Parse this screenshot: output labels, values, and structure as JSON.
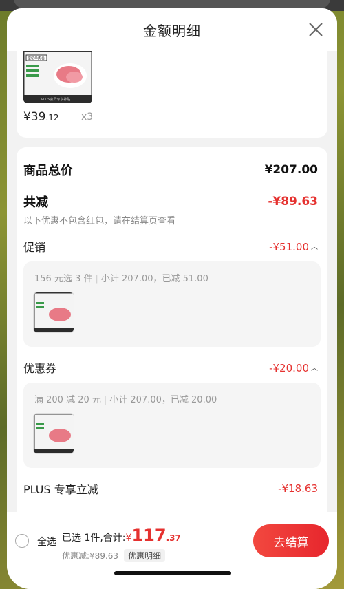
{
  "sheet": {
    "title": "金额明细"
  },
  "product": {
    "thumb_title": "原切羊肉卷",
    "thumb_footer": "PLUS会员专享补贴",
    "price_int": "¥39",
    "price_dec": ".12",
    "qty": "x3"
  },
  "summary": {
    "total_label": "商品总价",
    "total_value": "¥207.00",
    "discount_label": "共减",
    "discount_value": "-¥89.63",
    "note": "以下优惠不包含红包，请在结算页查看"
  },
  "promo": {
    "label": "促销",
    "value": "-¥51.00",
    "detail_rule": "156 元选 3 件",
    "detail_subtotal": "小计 207.00，已减 51.00"
  },
  "coupon": {
    "label": "优惠券",
    "value": "-¥20.00",
    "detail_rule": "满 200 减 20 元",
    "detail_subtotal": "小计 207.00，已减 20.00"
  },
  "plus": {
    "label": "PLUS 专享立减",
    "value": "-¥18.63"
  },
  "bottom": {
    "select_all": "全选",
    "selected_text": "已选 1件,合计:",
    "currency": "¥",
    "total_int": "117",
    "total_dec": ".37",
    "discount_text": "优惠减:¥89.63",
    "detail_chip": "优惠明细",
    "checkout": "去结算"
  },
  "colors": {
    "accent_red": "#e5312f",
    "button_red": "#ee2f35"
  }
}
